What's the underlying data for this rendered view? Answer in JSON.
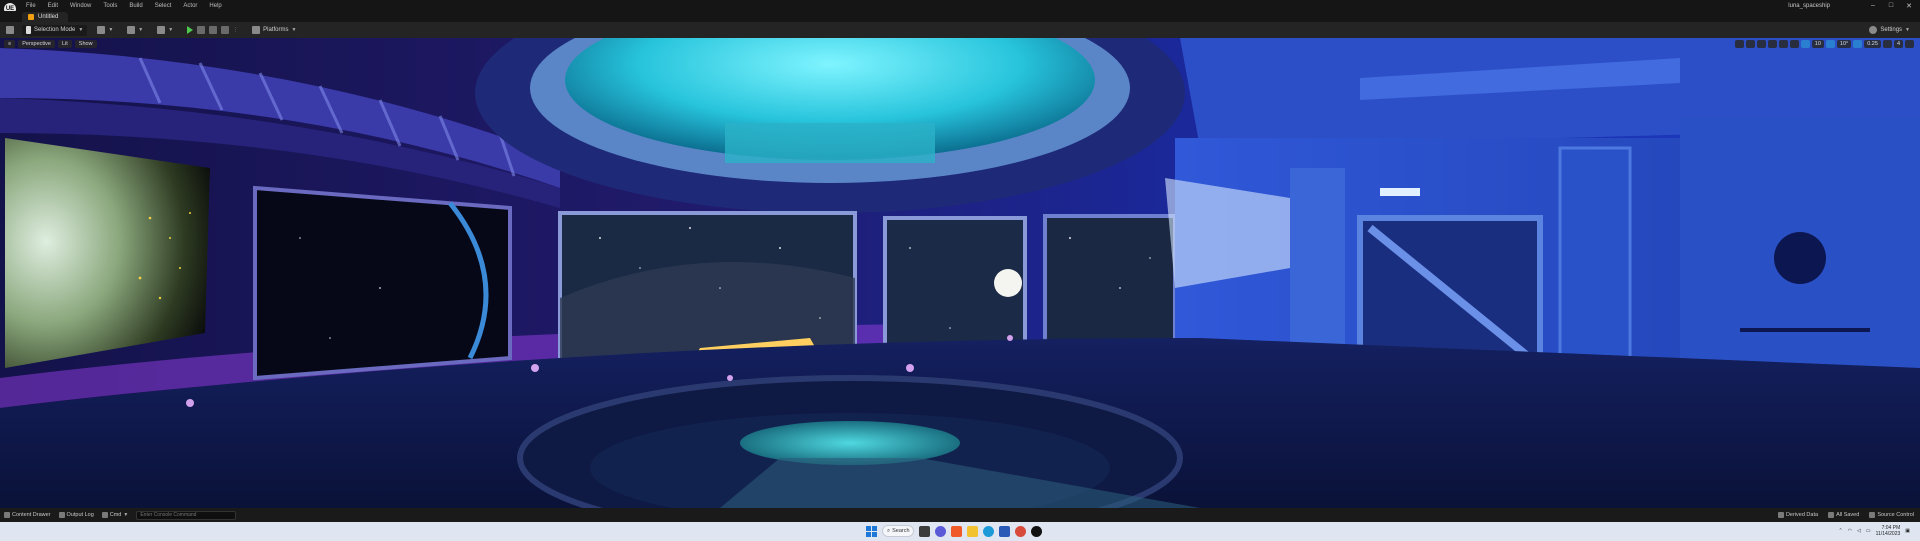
{
  "app": {
    "logo": "UE",
    "menu": [
      "File",
      "Edit",
      "Window",
      "Tools",
      "Build",
      "Select",
      "Actor",
      "Help"
    ],
    "project_name": "luna_spaceship",
    "window_controls": {
      "minimize": "–",
      "maximize": "□",
      "close": "✕"
    }
  },
  "tabs": {
    "level": "Untitled"
  },
  "toolbar": {
    "mode_label": "Selection Mode",
    "platforms_label": "Platforms",
    "settings_label": "Settings"
  },
  "viewport": {
    "menu_glyph": "≡",
    "perspective_label": "Perspective",
    "lit_label": "Lit",
    "show_label": "Show",
    "grid_value": "10",
    "angle_value": "10°",
    "scale_value": "0.25",
    "camera_speed": "4"
  },
  "statusbar": {
    "content_drawer": "Content Drawer",
    "output_log": "Output Log",
    "cmd_label": "Cmd",
    "cmd_placeholder": "Enter Console Command",
    "derived_data": "Derived Data",
    "all_saved": "All Saved",
    "source_control": "Source Control"
  },
  "taskbar": {
    "search_label": "Search",
    "time": "7:04 PM",
    "date": "11/14/2023"
  }
}
